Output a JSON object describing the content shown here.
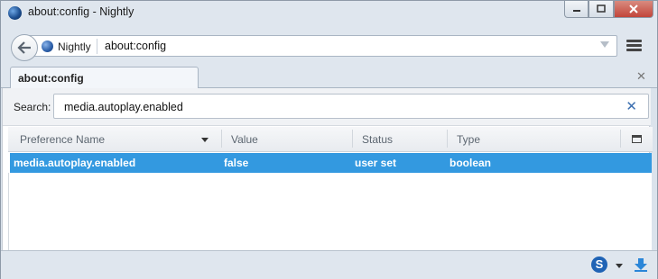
{
  "window": {
    "title": "about:config - Nightly"
  },
  "navbar": {
    "identity_label": "Nightly",
    "url": "about:config"
  },
  "tabs": [
    {
      "label": "about:config"
    }
  ],
  "search": {
    "label": "Search:",
    "value": "media.autoplay.enabled"
  },
  "table": {
    "columns": [
      "Preference Name",
      "Value",
      "Status",
      "Type"
    ],
    "rows": [
      {
        "name": "media.autoplay.enabled",
        "value": "false",
        "status": "user set",
        "type": "boolean"
      }
    ]
  },
  "colors": {
    "selection": "#3399e0",
    "chrome": "#dfe6ee"
  }
}
